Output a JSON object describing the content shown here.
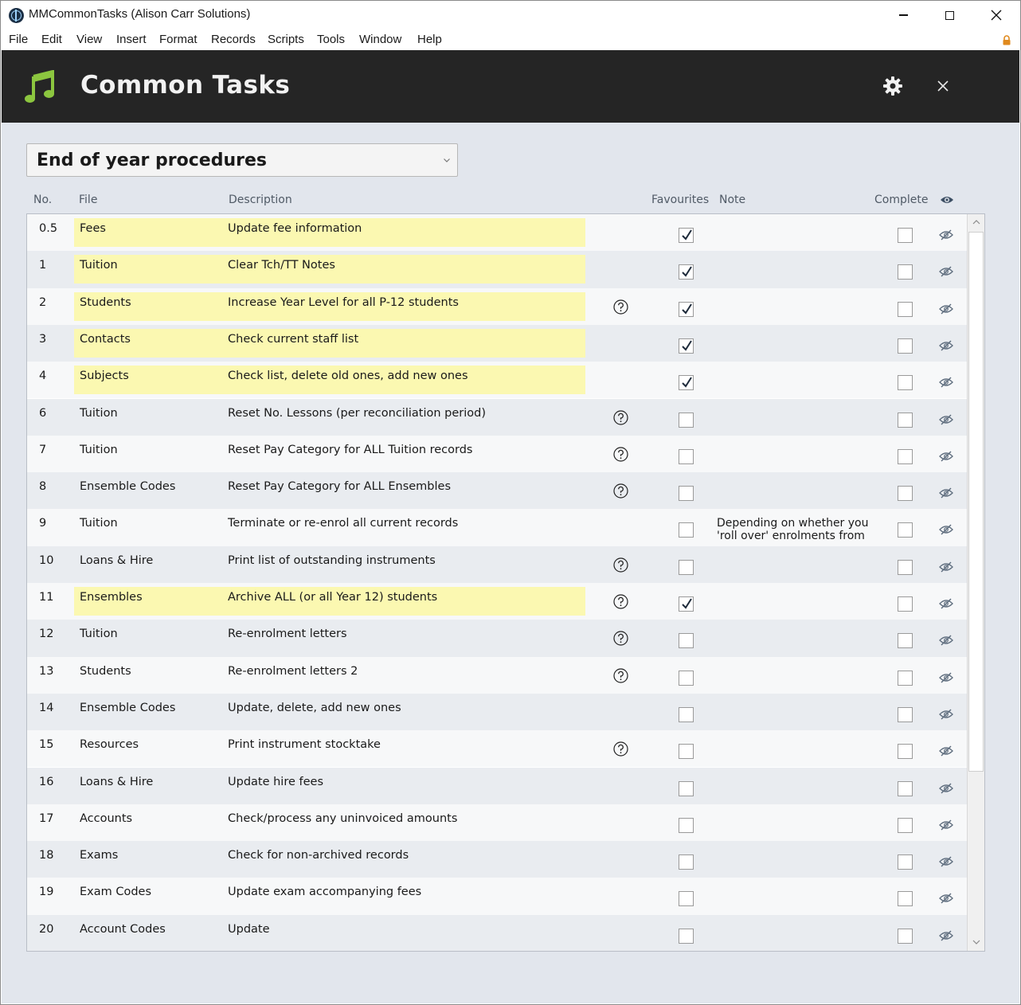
{
  "window": {
    "title": "MMCommonTasks (Alison Carr Solutions)"
  },
  "menu": [
    "File",
    "Edit",
    "View",
    "Insert",
    "Format",
    "Records",
    "Scripts",
    "Tools",
    "Window",
    "Help"
  ],
  "header": {
    "title": "Common Tasks",
    "accent_color": "#8cc63f",
    "background": "#252525"
  },
  "dropdown": {
    "selected": "End of year procedures"
  },
  "columns": {
    "no": "No.",
    "file": "File",
    "description": "Description",
    "favourites": "Favourites",
    "note": "Note",
    "complete": "Complete"
  },
  "colors": {
    "highlight": "#fbf8b1",
    "content_bg": "#e2e6ed"
  },
  "tasks": [
    {
      "no": "0.5",
      "file": "Fees",
      "description": "Update fee information",
      "help": false,
      "favourite": true,
      "note": "",
      "complete": false
    },
    {
      "no": "1",
      "file": "Tuition",
      "description": "Clear Tch/TT Notes",
      "help": false,
      "favourite": true,
      "note": "",
      "complete": false
    },
    {
      "no": "2",
      "file": "Students",
      "description": "Increase Year Level for all P-12 students",
      "help": true,
      "favourite": true,
      "note": "",
      "complete": false
    },
    {
      "no": "3",
      "file": "Contacts",
      "description": "Check current staff list",
      "help": false,
      "favourite": true,
      "note": "",
      "complete": false
    },
    {
      "no": "4",
      "file": "Subjects",
      "description": "Check list, delete old ones, add new ones",
      "help": false,
      "favourite": true,
      "note": "",
      "complete": false
    },
    {
      "no": "6",
      "file": "Tuition",
      "description": "Reset No. Lessons (per reconciliation period)",
      "help": true,
      "favourite": false,
      "note": "",
      "complete": false
    },
    {
      "no": "7",
      "file": "Tuition",
      "description": "Reset Pay Category for ALL Tuition records",
      "help": true,
      "favourite": false,
      "note": "",
      "complete": false
    },
    {
      "no": "8",
      "file": "Ensemble Codes",
      "description": "Reset Pay Category for ALL Ensembles",
      "help": true,
      "favourite": false,
      "note": "",
      "complete": false
    },
    {
      "no": "9",
      "file": "Tuition",
      "description": "Terminate or re-enrol all current records",
      "help": false,
      "favourite": false,
      "note": "Depending on whether you 'roll over' enrolments from",
      "complete": false
    },
    {
      "no": "10",
      "file": "Loans & Hire",
      "description": "Print list of outstanding instruments",
      "help": true,
      "favourite": false,
      "note": "",
      "complete": false
    },
    {
      "no": "11",
      "file": "Ensembles",
      "description": "Archive ALL (or all Year 12) students",
      "help": true,
      "favourite": true,
      "note": "",
      "complete": false
    },
    {
      "no": "12",
      "file": "Tuition",
      "description": "Re-enrolment letters",
      "help": true,
      "favourite": false,
      "note": "",
      "complete": false
    },
    {
      "no": "13",
      "file": "Students",
      "description": "Re-enrolment letters 2",
      "help": true,
      "favourite": false,
      "note": "",
      "complete": false
    },
    {
      "no": "14",
      "file": "Ensemble Codes",
      "description": "Update, delete, add new ones",
      "help": false,
      "favourite": false,
      "note": "",
      "complete": false
    },
    {
      "no": "15",
      "file": "Resources",
      "description": "Print instrument stocktake",
      "help": true,
      "favourite": false,
      "note": "",
      "complete": false
    },
    {
      "no": "16",
      "file": "Loans & Hire",
      "description": "Update hire fees",
      "help": false,
      "favourite": false,
      "note": "",
      "complete": false
    },
    {
      "no": "17",
      "file": "Accounts",
      "description": "Check/process any uninvoiced amounts",
      "help": false,
      "favourite": false,
      "note": "",
      "complete": false
    },
    {
      "no": "18",
      "file": "Exams",
      "description": "Check for non-archived records",
      "help": false,
      "favourite": false,
      "note": "",
      "complete": false
    },
    {
      "no": "19",
      "file": "Exam Codes",
      "description": "Update exam accompanying fees",
      "help": false,
      "favourite": false,
      "note": "",
      "complete": false
    },
    {
      "no": "20",
      "file": "Account Codes",
      "description": "Update",
      "help": false,
      "favourite": false,
      "note": "",
      "complete": false
    }
  ]
}
